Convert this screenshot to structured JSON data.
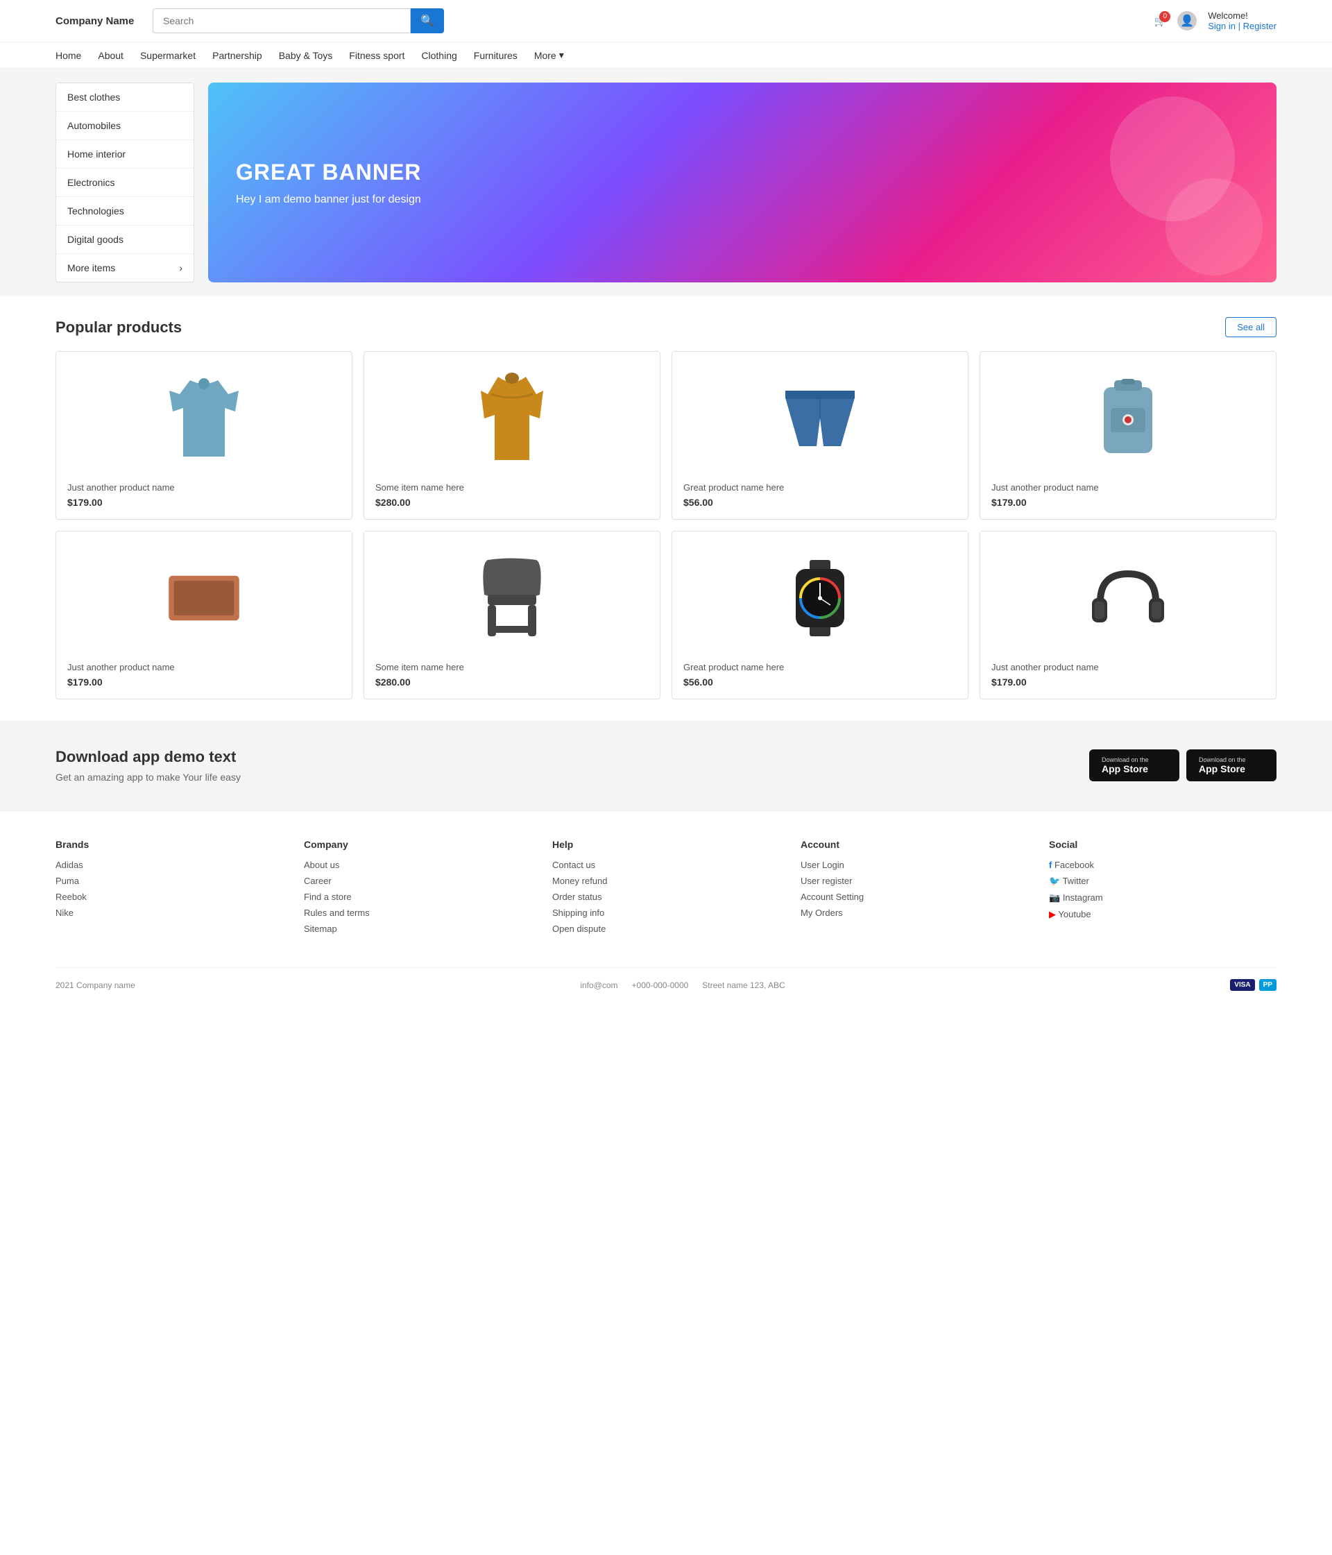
{
  "header": {
    "logo": "Company Name",
    "search_placeholder": "Search",
    "cart_count": "0",
    "welcome": "Welcome!",
    "sign_in": "Sign in | Register"
  },
  "nav": {
    "items": [
      {
        "label": "Home",
        "id": "home"
      },
      {
        "label": "About",
        "id": "about"
      },
      {
        "label": "Supermarket",
        "id": "supermarket"
      },
      {
        "label": "Partnership",
        "id": "partnership"
      },
      {
        "label": "Baby &amp; Toys",
        "id": "baby-toys"
      },
      {
        "label": "Fitness sport",
        "id": "fitness"
      },
      {
        "label": "Clothing",
        "id": "clothing"
      },
      {
        "label": "Furnitures",
        "id": "furnitures"
      }
    ],
    "more_label": "More"
  },
  "sidebar": {
    "items": [
      {
        "label": "Best clothes"
      },
      {
        "label": "Automobiles"
      },
      {
        "label": "Home interior"
      },
      {
        "label": "Electronics"
      },
      {
        "label": "Technologies"
      },
      {
        "label": "Digital goods"
      },
      {
        "label": "More items",
        "has_arrow": true
      }
    ]
  },
  "banner": {
    "title": "GREAT BANNER",
    "subtitle": "Hey I am demo banner just for design"
  },
  "products": {
    "section_title": "Popular products",
    "see_all_label": "See all",
    "items": [
      {
        "name": "Just another product name",
        "price": "$179.00",
        "type": "polo"
      },
      {
        "name": "Some item name here",
        "price": "$280.00",
        "type": "jacket"
      },
      {
        "name": "Great product name here",
        "price": "$56.00",
        "type": "shorts"
      },
      {
        "name": "Just another product name",
        "price": "$179.00",
        "type": "backpack"
      },
      {
        "name": "Just another product name",
        "price": "$179.00",
        "type": "laptop"
      },
      {
        "name": "Some item name here",
        "price": "$280.00",
        "type": "chair"
      },
      {
        "name": "Great product name here",
        "price": "$56.00",
        "type": "watch"
      },
      {
        "name": "Just another product name",
        "price": "$179.00",
        "type": "headphones"
      }
    ]
  },
  "app_section": {
    "title": "Download app demo text",
    "subtitle": "Get an amazing app to make Your life easy",
    "btn1_top": "Download on the",
    "btn1_name": "App Store",
    "btn2_top": "Download on the",
    "btn2_name": "App Store"
  },
  "footer": {
    "brands": {
      "title": "Brands",
      "links": [
        "Adidas",
        "Puma",
        "Reebok",
        "Nike"
      ]
    },
    "company": {
      "title": "Company",
      "links": [
        "About us",
        "Career",
        "Find a store",
        "Rules and terms",
        "Sitemap"
      ]
    },
    "help": {
      "title": "Help",
      "links": [
        "Contact us",
        "Money refund",
        "Order status",
        "Shipping info",
        "Open dispute"
      ]
    },
    "account": {
      "title": "Account",
      "links": [
        "User Login",
        "User register",
        "Account Setting",
        "My Orders"
      ]
    },
    "social": {
      "title": "Social",
      "links": [
        {
          "label": "Facebook",
          "icon": "f"
        },
        {
          "label": "Twitter",
          "icon": "t"
        },
        {
          "label": "Instagram",
          "icon": "i"
        },
        {
          "label": "Youtube",
          "icon": "y"
        }
      ]
    },
    "bottom": {
      "copyright": "2021 Company name",
      "email": "info@com",
      "phone": "+000-000-0000",
      "address": "Street name 123, ABC"
    }
  }
}
